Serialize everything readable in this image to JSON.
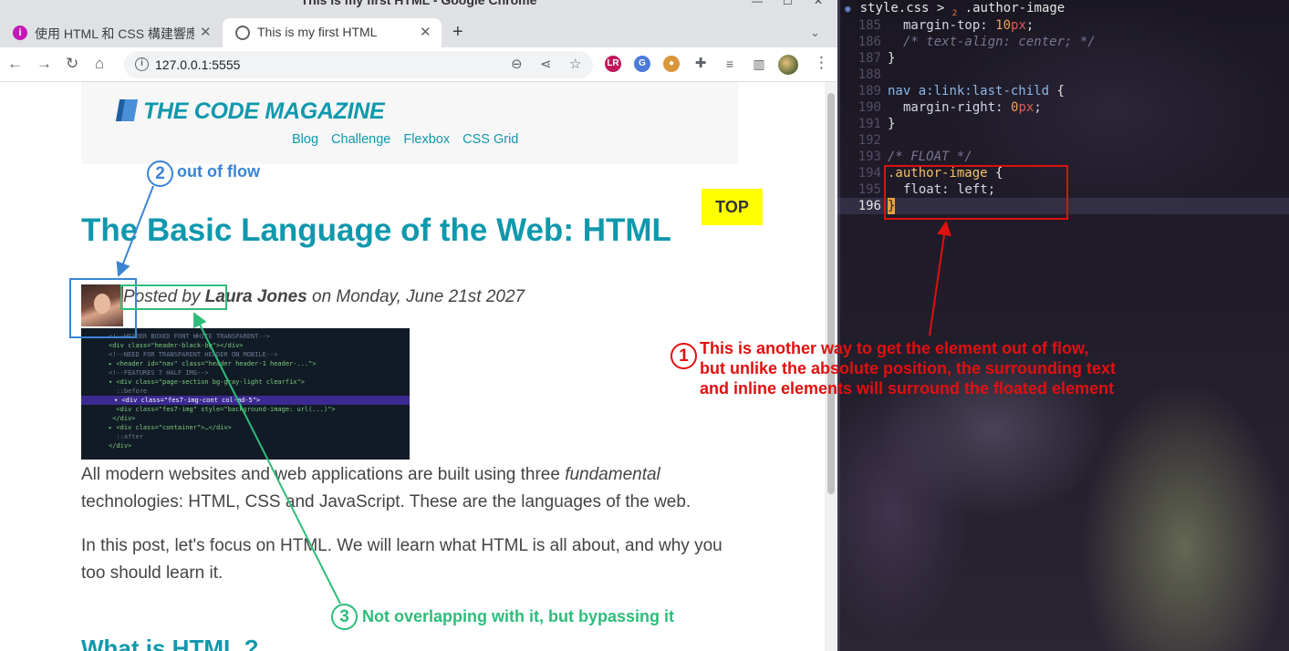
{
  "window": {
    "title": "This is my first HTML - Google Chrome"
  },
  "tabs": [
    {
      "label": "使用 HTML 和 CSS 構建響應",
      "favicon": "info-circle-icon"
    },
    {
      "label": "This is my first HTML",
      "favicon": "broadcast-icon"
    }
  ],
  "address_bar": {
    "url": "127.0.0.1:5555"
  },
  "page": {
    "logo": "THE CODE MAGAZINE",
    "nav": [
      "Blog",
      "Challenge",
      "Flexbox",
      "CSS Grid"
    ],
    "top_badge": "TOP",
    "title": "The Basic Language of the Web: HTML",
    "byline": {
      "prefix": "Posted by ",
      "author": "Laura Jones",
      "suffix": " on Monday, June 21st 2027"
    },
    "para1_a": "All modern websites and web applications are built using three ",
    "para1_em": "fundamental",
    "para1_b": " technologies: HTML, CSS and JavaScript. These are the languages of the web.",
    "para2": "In this post, let's focus on HTML. We will learn what HTML is all about, and why you too should learn it.",
    "h2": "What is HTML ?"
  },
  "annotations": {
    "a1_number": "1",
    "a1_lines": [
      "This is another way to get the element out of flow,",
      "but unlike the absolute position, the surrounding text",
      "and inline elements will surround the floated element"
    ],
    "a2_number": "2",
    "a2_text": "out of flow",
    "a3_number": "3",
    "a3_text": "Not overlapping with it, but bypassing it"
  },
  "editor": {
    "breadcrumb_file": "style.css",
    "breadcrumb_sep": ">",
    "breadcrumb_badge": "2",
    "breadcrumb_selector": ".author-image",
    "lines": [
      {
        "n": "185",
        "text": "margin-top: 10px;"
      },
      {
        "n": "186",
        "text": "/* text-align: center; */"
      },
      {
        "n": "187",
        "text": "}"
      },
      {
        "n": "188",
        "text": ""
      },
      {
        "n": "189",
        "text": "nav a:link:last-child {"
      },
      {
        "n": "190",
        "text": "margin-right: 0px;"
      },
      {
        "n": "191",
        "text": "}"
      },
      {
        "n": "192",
        "text": ""
      },
      {
        "n": "193",
        "text": "/* FLOAT */"
      },
      {
        "n": "194",
        "text": ".author-image {"
      },
      {
        "n": "195",
        "text": "float: left;"
      },
      {
        "n": "196",
        "text": "}"
      }
    ]
  },
  "colors": {
    "accent": "#1098ad",
    "annotation_red": "#e01010",
    "annotation_blue": "#3a84d6",
    "annotation_green": "#2dbd7a",
    "badge_yellow": "#ffff00"
  }
}
